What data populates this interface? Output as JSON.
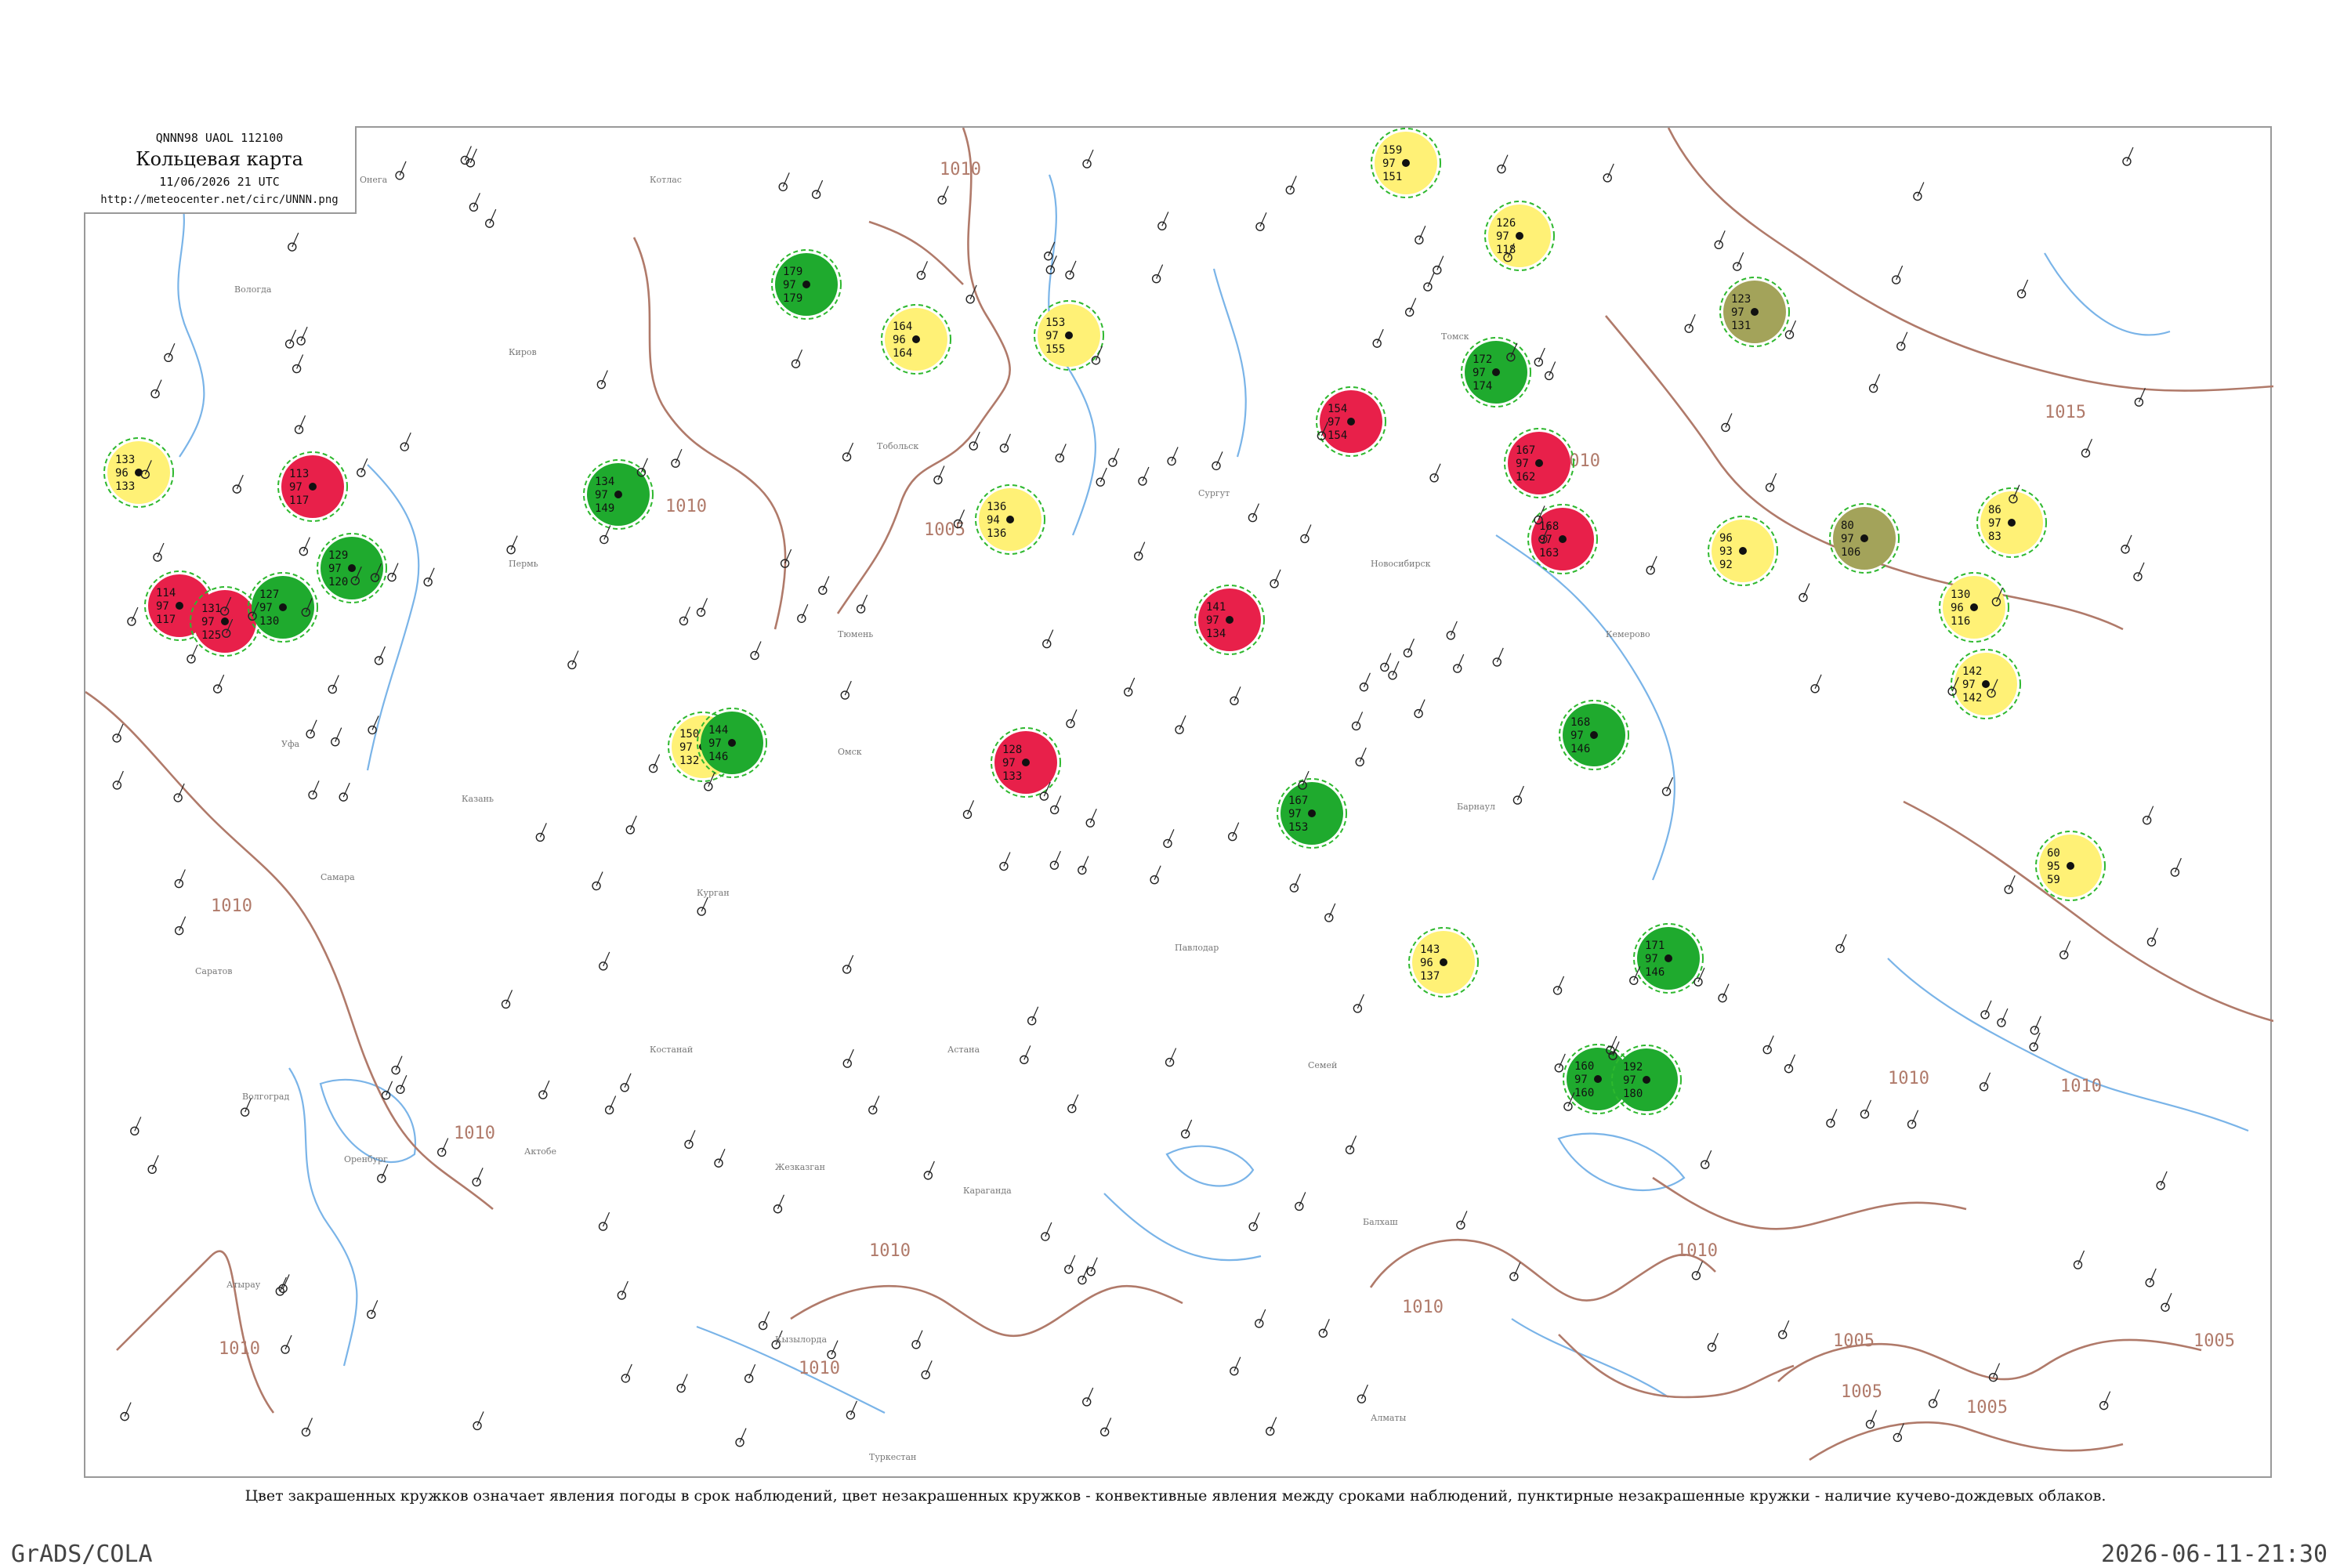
{
  "header": {
    "code": "QNNN98  UAOL  112100",
    "title": "Кольцевая карта",
    "datetime": "11/06/2026 21 UTC",
    "url": "http://meteocenter.net/circ/UNNN.png"
  },
  "caption": "Цвет закрашенных кружков означает явления погоды в срок наблюдений, цвет незакрашенных кружков - конвективные явления между сроками наблюдений, пунктирные незакрашенные кружки - наличие кучево-дождевых облаков.",
  "footer": {
    "left": "GrADS/COLA",
    "right": "2026-06-11-21:30"
  },
  "colors": {
    "isobar": "#b07a6a",
    "river": "#7ab4e8",
    "green": "#1faa2e",
    "red": "#e8204a",
    "yellow": "#fff176",
    "olive": "#a3a35a",
    "dashed_green": "#2eb82e",
    "outline_red": "#d4486a"
  },
  "isobar_labels": [
    "1010",
    "1005",
    "1015",
    "1010",
    "1010",
    "1010",
    "1005",
    "1010",
    "1005",
    "1010",
    "1010",
    "1005",
    "1005",
    "1010",
    "1010",
    "1010",
    "1010",
    "1010"
  ],
  "stations": [
    {
      "marker": "red",
      "pressure": "114",
      "temp": "97",
      "dew": "117"
    },
    {
      "marker": "red",
      "pressure": "131",
      "temp": "97",
      "dew": "125"
    },
    {
      "marker": "green",
      "pressure": "127",
      "temp": "97",
      "dew": "130"
    },
    {
      "marker": "green",
      "pressure": "129",
      "temp": "97",
      "dew": "120"
    },
    {
      "marker": "red",
      "pressure": "113",
      "temp": "97",
      "dew": "117"
    },
    {
      "marker": "yellow",
      "pressure": "133",
      "temp": "96",
      "dew": "133"
    },
    {
      "marker": "green",
      "pressure": "134",
      "temp": "97",
      "dew": "149"
    },
    {
      "marker": "yellow",
      "pressure": "150",
      "temp": "97",
      "dew": "132"
    },
    {
      "marker": "green",
      "pressure": "144",
      "temp": "97",
      "dew": "146"
    },
    {
      "marker": "green",
      "pressure": "179",
      "temp": "97",
      "dew": "179"
    },
    {
      "marker": "yellow",
      "pressure": "164",
      "temp": "96",
      "dew": "164"
    },
    {
      "marker": "yellow",
      "pressure": "153",
      "temp": "97",
      "dew": "155"
    },
    {
      "marker": "yellow",
      "pressure": "136",
      "temp": "94",
      "dew": "136"
    },
    {
      "marker": "red",
      "pressure": "128",
      "temp": "97",
      "dew": "133"
    },
    {
      "marker": "red",
      "pressure": "141",
      "temp": "97",
      "dew": "134"
    },
    {
      "marker": "green",
      "pressure": "167",
      "temp": "97",
      "dew": "153"
    },
    {
      "marker": "red",
      "pressure": "154",
      "temp": "97",
      "dew": "154"
    },
    {
      "marker": "yellow",
      "pressure": "159",
      "temp": "97",
      "dew": "151"
    },
    {
      "marker": "yellow",
      "pressure": "126",
      "temp": "97",
      "dew": "118"
    },
    {
      "marker": "green",
      "pressure": "172",
      "temp": "97",
      "dew": "174"
    },
    {
      "marker": "red",
      "pressure": "167",
      "temp": "97",
      "dew": "162"
    },
    {
      "marker": "red",
      "pressure": "168",
      "temp": "97",
      "dew": "163"
    },
    {
      "marker": "green",
      "pressure": "168",
      "temp": "97",
      "dew": "146"
    },
    {
      "marker": "green",
      "pressure": "171",
      "temp": "97",
      "dew": "146"
    },
    {
      "marker": "green",
      "pressure": "160",
      "temp": "97",
      "dew": "160"
    },
    {
      "marker": "green",
      "pressure": "192",
      "temp": "97",
      "dew": "180"
    },
    {
      "marker": "yellow",
      "pressure": "96",
      "temp": "93",
      "dew": "92"
    },
    {
      "marker": "olive",
      "pressure": "80",
      "temp": "97",
      "dew": "106"
    },
    {
      "marker": "olive",
      "pressure": "123",
      "temp": "97",
      "dew": "131"
    },
    {
      "marker": "yellow",
      "pressure": "86",
      "temp": "97",
      "dew": "83"
    },
    {
      "marker": "yellow",
      "pressure": "130",
      "temp": "96",
      "dew": "116"
    },
    {
      "marker": "yellow",
      "pressure": "142",
      "temp": "97",
      "dew": "142"
    },
    {
      "marker": "yellow",
      "pressure": "60",
      "temp": "95",
      "dew": "59"
    },
    {
      "marker": "yellow",
      "pressure": "143",
      "temp": "96",
      "dew": "137"
    }
  ],
  "place_names": [
    "Онега",
    "Котлас",
    "Вологда",
    "Киров",
    "Пермь",
    "Уфа",
    "Казань",
    "Самара",
    "Саратов",
    "Волгоград",
    "Оренбург",
    "Актобе",
    "Атырау",
    "Сургут",
    "Тобольск",
    "Тюмень",
    "Омск",
    "Курган",
    "Костанай",
    "Астана",
    "Караганда",
    "Павлодар",
    "Семей",
    "Барнаул",
    "Новосибирск",
    "Томск",
    "Кемерово",
    "Балхаш",
    "Жезказган",
    "Кызылорда",
    "Туркестан",
    "Алматы"
  ]
}
